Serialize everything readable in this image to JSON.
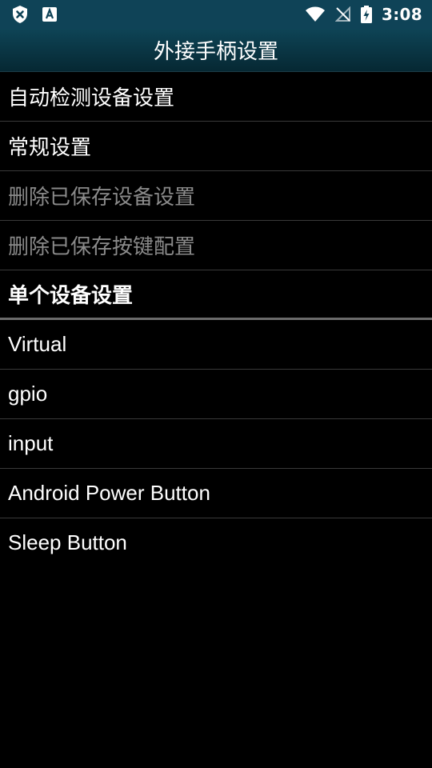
{
  "status_bar": {
    "time": "3:08",
    "left_icons": [
      "shield-x-icon",
      "font-a-icon"
    ],
    "right_icons": [
      "wifi-icon",
      "signal-off-icon",
      "battery-charging-icon"
    ]
  },
  "title": "外接手柄设置",
  "menu": [
    {
      "label": "自动检测设备设置",
      "enabled": true
    },
    {
      "label": "常规设置",
      "enabled": true
    },
    {
      "label": "删除已保存设备设置",
      "enabled": false
    },
    {
      "label": "删除已保存按键配置",
      "enabled": false
    }
  ],
  "section_header": "单个设备设置",
  "devices": [
    "Virtual",
    "gpio",
    "input",
    "Android Power Button",
    "Sleep Button"
  ],
  "colors": {
    "status_bar": "#0f4357",
    "title_bar": "#0a3646",
    "divider": "#3a3a3a",
    "disabled_text": "#8a8a8a"
  }
}
